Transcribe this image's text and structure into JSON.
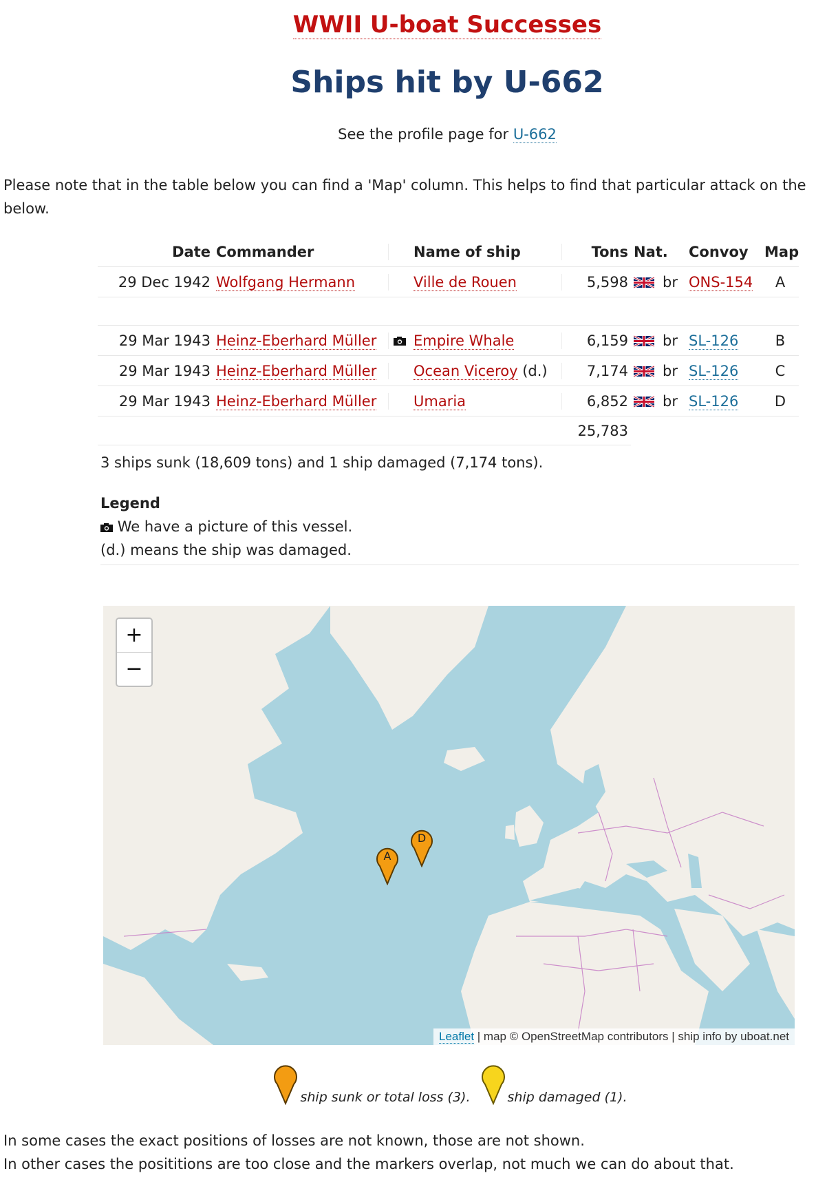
{
  "header": {
    "site_title": "WWII U-boat Successes",
    "page_title": "Ships hit by U-662",
    "profile_prefix": "See the profile page for",
    "profile_link": "U-662"
  },
  "note": "Please note that in the table below you can find a 'Map' column. This helps to find that particular attack on the below.",
  "table": {
    "headers": {
      "date": "Date",
      "commander": "Commander",
      "ship": "Name of ship",
      "tons": "Tons",
      "nat": "Nat.",
      "convoy": "Convoy",
      "map": "Map"
    },
    "rows": [
      {
        "date": "29 Dec 1942",
        "commander": "Wolfgang Hermann",
        "picture": false,
        "ship": "Ville de Rouen",
        "damaged": "",
        "tons": "5,598",
        "nat": "br",
        "convoy": "ONS-154",
        "map": "A"
      },
      {
        "date": "29 Mar 1943",
        "commander": "Heinz-Eberhard Müller",
        "picture": true,
        "ship": "Empire Whale",
        "damaged": "",
        "tons": "6,159",
        "nat": "br",
        "convoy": "SL-126",
        "map": "B"
      },
      {
        "date": "29 Mar 1943",
        "commander": "Heinz-Eberhard Müller",
        "picture": false,
        "ship": "Ocean Viceroy",
        "damaged": "(d.)",
        "tons": "7,174",
        "nat": "br",
        "convoy": "SL-126",
        "map": "C"
      },
      {
        "date": "29 Mar 1943",
        "commander": "Heinz-Eberhard Müller",
        "picture": false,
        "ship": "Umaria",
        "damaged": "",
        "tons": "6,852",
        "nat": "br",
        "convoy": "SL-126",
        "map": "D"
      }
    ],
    "total_tons": "25,783"
  },
  "summary": "3 ships sunk (18,609 tons) and 1 ship damaged (7,174 tons).",
  "legend": {
    "title": "Legend",
    "picture_text": "We have a picture of this vessel.",
    "damaged_text": "(d.) means the ship was damaged."
  },
  "map": {
    "zoom_in": "+",
    "zoom_out": "−",
    "attribution_link": "Leaflet",
    "attribution_text": "| map © OpenStreetMap contributors | ship info by uboat.net",
    "markers": [
      "A",
      "D"
    ],
    "colors": {
      "sunk": "#f39c12",
      "damaged": "#f7d51d",
      "water": "#aad3df",
      "land": "#f2efe9",
      "border": "#c77fc6"
    }
  },
  "map_legend": {
    "sunk": "ship sunk or total loss (3).",
    "damaged": "ship damaged (1)."
  },
  "footer": {
    "line1": "In some cases the exact positions of losses are not known, those are not shown.",
    "line2": "In other cases the posititions are too close and the markers overlap, not much we can do about that."
  },
  "icons": {
    "flag": "uk-flag-icon",
    "camera": "camera-icon",
    "marker": "map-marker-icon"
  }
}
